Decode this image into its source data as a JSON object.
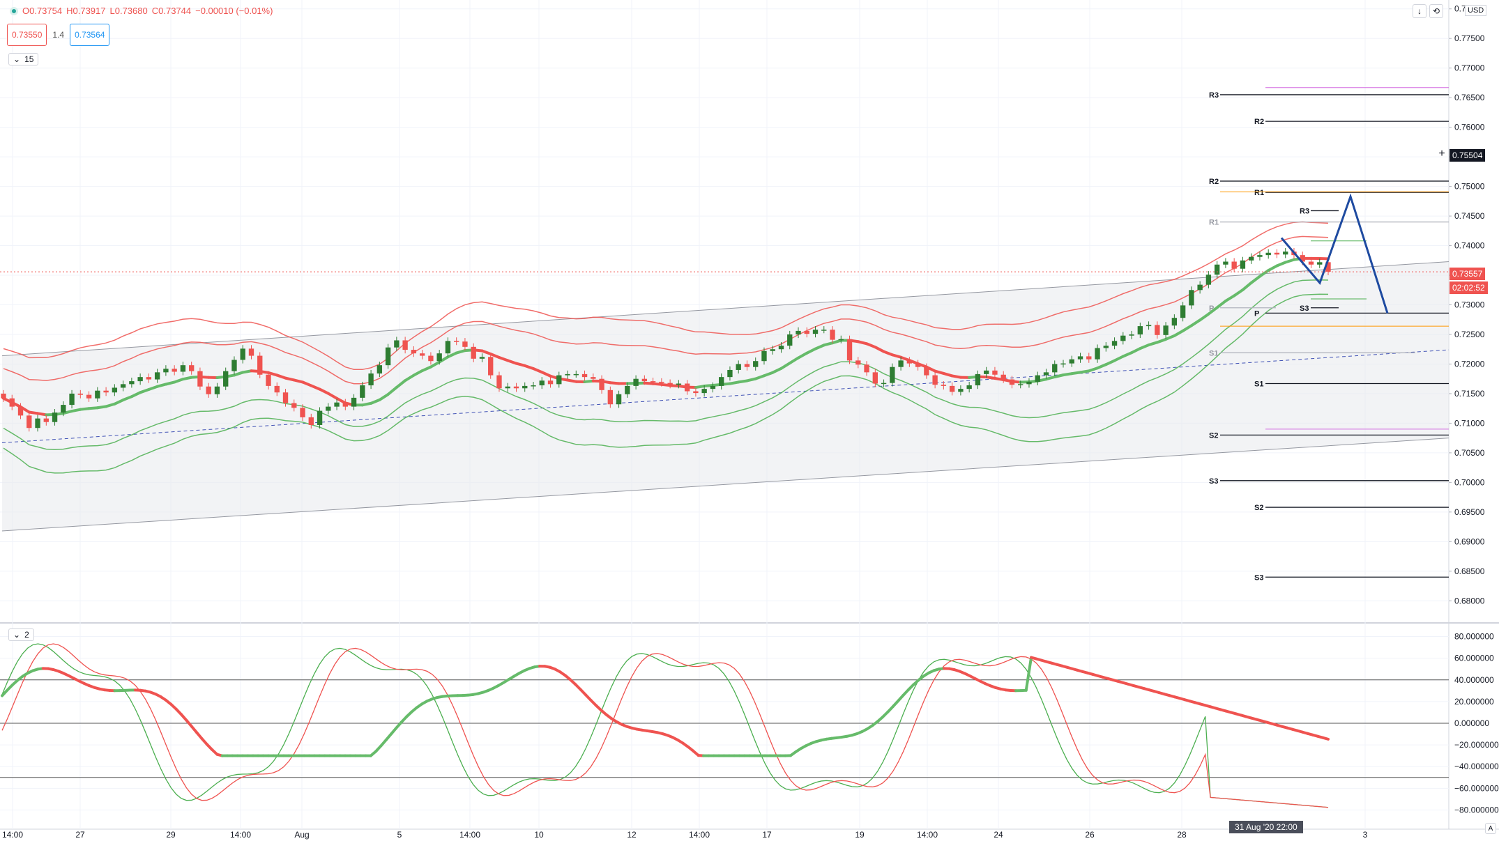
{
  "toolbar": {
    "ohlc_open": "O0.73754",
    "ohlc_high": "H0.73917",
    "ohlc_low": "L0.73680",
    "ohlc_close": "C0.73744",
    "ohlc_change": "−0.00010 (−0.01%)",
    "sell_price": "0.73550",
    "spread": "1.4",
    "buy_price": "0.73564",
    "interval": "15",
    "oscillator_tag": "2",
    "currency": "USD",
    "down_icon": "arrow-down-icon",
    "settings_icon": "chart-settings-icon",
    "scale_icon": "auto-scale-icon"
  },
  "price_axis": {
    "current_price": "0.73557",
    "countdown": "02:02:52",
    "crosshair_price": "0.75504"
  },
  "time_axis": {
    "crosshair_label": "31 Aug '20   22:00"
  },
  "colors": {
    "up": "#2e7d32",
    "down": "#ef5350",
    "channel_fill": "#e8e9ec",
    "forecast": "#1e4aa0"
  },
  "chart_data": [
    {
      "type": "candlestick",
      "symbol": "AUD/USD",
      "interval": "15",
      "x_ticks": [
        "14:00",
        "27",
        "29",
        "14:00",
        "Aug",
        "5",
        "14:00",
        "10",
        "12",
        "14:00",
        "17",
        "19",
        "14:00",
        "24",
        "26",
        "28",
        "3"
      ],
      "y_ticks": [
        "0.78000",
        "0.77500",
        "0.77000",
        "0.76500",
        "0.76000",
        "0.75500",
        "0.75000",
        "0.74500",
        "0.74000",
        "0.73500",
        "0.73000",
        "0.72500",
        "0.72000",
        "0.71500",
        "0.71000",
        "0.70500",
        "0.70000",
        "0.69500",
        "0.69000",
        "0.68500",
        "0.68000"
      ],
      "ylim": [
        0.6765,
        0.7815
      ],
      "closes": [
        0.7142,
        0.7128,
        0.7113,
        0.7092,
        0.7108,
        0.7102,
        0.7118,
        0.7131,
        0.715,
        0.7148,
        0.7142,
        0.7155,
        0.7152,
        0.716,
        0.7166,
        0.7171,
        0.7178,
        0.7174,
        0.7186,
        0.7192,
        0.7187,
        0.7198,
        0.7188,
        0.7162,
        0.7149,
        0.7162,
        0.7188,
        0.7207,
        0.7226,
        0.7214,
        0.7182,
        0.7163,
        0.7152,
        0.7134,
        0.7126,
        0.711,
        0.7097,
        0.7121,
        0.7128,
        0.7135,
        0.7128,
        0.7143,
        0.7164,
        0.7184,
        0.7198,
        0.7228,
        0.724,
        0.7224,
        0.7218,
        0.7214,
        0.7205,
        0.7218,
        0.7239,
        0.7238,
        0.7229,
        0.7209,
        0.7212,
        0.7181,
        0.7159,
        0.7162,
        0.7159,
        0.7163,
        0.7164,
        0.7172,
        0.7166,
        0.7181,
        0.7183,
        0.7183,
        0.7178,
        0.7175,
        0.7156,
        0.7132,
        0.7149,
        0.7163,
        0.7175,
        0.7171,
        0.717,
        0.7168,
        0.7165,
        0.7167,
        0.7154,
        0.7151,
        0.7158,
        0.7163,
        0.7178,
        0.719,
        0.72,
        0.7195,
        0.7205,
        0.7222,
        0.7225,
        0.7231,
        0.725,
        0.7256,
        0.7251,
        0.7258,
        0.7258,
        0.7241,
        0.7242,
        0.7206,
        0.7199,
        0.7186,
        0.7167,
        0.7168,
        0.7195,
        0.7206,
        0.7201,
        0.7195,
        0.7181,
        0.7165,
        0.7163,
        0.7153,
        0.7158,
        0.7164,
        0.7183,
        0.7189,
        0.7182,
        0.7174,
        0.7165,
        0.7166,
        0.717,
        0.7181,
        0.7186,
        0.72,
        0.7201,
        0.7208,
        0.7213,
        0.7208,
        0.7227,
        0.7231,
        0.7239,
        0.7248,
        0.725,
        0.7264,
        0.7266,
        0.7249,
        0.7265,
        0.7278,
        0.7299,
        0.7325,
        0.7334,
        0.7351,
        0.7368,
        0.7373,
        0.7361,
        0.7375,
        0.7381,
        0.7384,
        0.7388,
        0.7385,
        0.739,
        0.7384,
        0.7373,
        0.7368,
        0.7372,
        0.7356
      ],
      "pivots": {
        "weekly_a": {
          "R3": 0.7655,
          "R2": 0.7509,
          "R1": 0.744,
          "P": 0.7295,
          "S1": 0.7219,
          "S2": 0.708,
          "S3": 0.7003
        },
        "weekly_b": {
          "R2": 0.761,
          "R1": 0.749,
          "R3": 0.7459,
          "P": 0.7286,
          "S3": 0.7295,
          "S1": 0.7167,
          "S2": 0.6958,
          "S3b": 0.684
        }
      },
      "forecast_path": [
        0.7413,
        0.7337,
        0.7483,
        0.7286
      ],
      "oscillator": {
        "y_ticks": [
          "80.000000",
          "60.000000",
          "40.000000",
          "20.000000",
          "0.000000",
          "−20.000000",
          "−40.000000",
          "−60.000000",
          "−80.000000"
        ],
        "ylim": [
          -90,
          90
        ],
        "levels": [
          40,
          0,
          -50
        ]
      }
    }
  ]
}
